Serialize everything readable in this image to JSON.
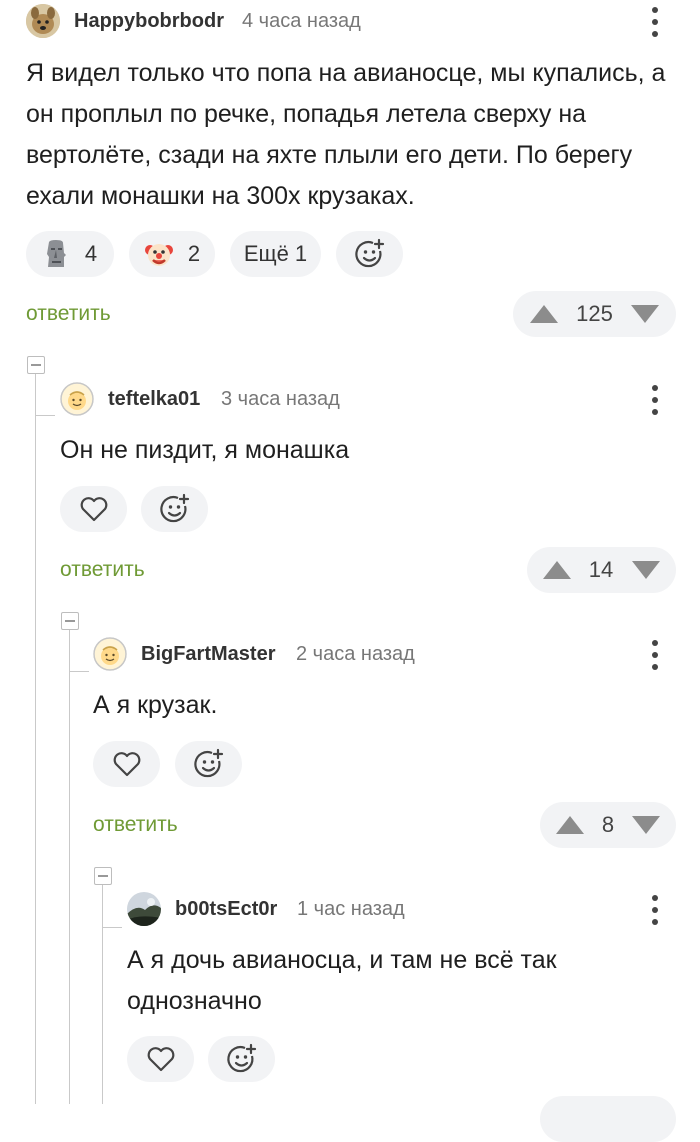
{
  "comments": [
    {
      "author": "Happybobrbodr",
      "time": "4 часа назад",
      "text": "Я видел только что попа на авианосце, мы купались, а он проплыл по речке, попадья летела сверху на вертолёте, сзади на яхте плыли его дети. По берегу ехали монашки на 300х крузаках.",
      "reactions": [
        {
          "icon": "moai-icon",
          "count": "4"
        },
        {
          "icon": "clown-icon",
          "count": "2"
        }
      ],
      "more_label": "Ещё 1",
      "reply_label": "ответить",
      "rating": "125"
    },
    {
      "author": "teftelka01",
      "time": "3 часа назад",
      "text": "Он не пиздит, я монашка",
      "reply_label": "ответить",
      "rating": "14"
    },
    {
      "author": "BigFartMaster",
      "time": "2 часа назад",
      "text": "А я крузак.",
      "reply_label": "ответить",
      "rating": "8"
    },
    {
      "author": "b00tsEct0r",
      "time": "1 час назад",
      "text": "А я дочь авианосца, и там не всё так однозначно"
    }
  ],
  "colors": {
    "reply_link": "#6f9a35",
    "pill_bg": "#f2f3f5",
    "thread_line": "#c9c9c9"
  }
}
